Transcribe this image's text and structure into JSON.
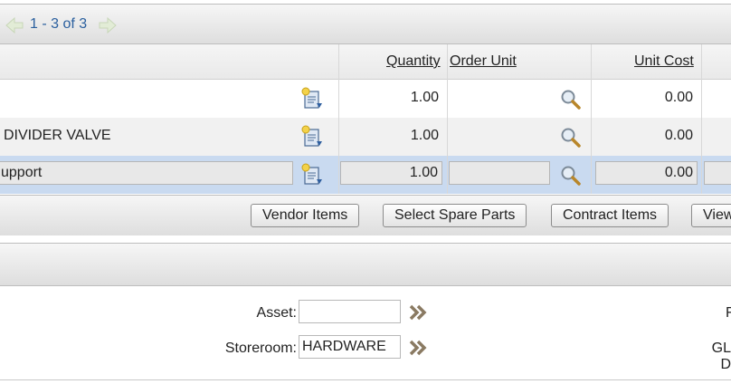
{
  "pager": {
    "range": "1 - 3 of 3",
    "prev_icon": "arrow-left-icon",
    "next_icon": "arrow-right-icon"
  },
  "columns": {
    "quantity": "Quantity",
    "order_unit": "Order Unit",
    "unit_cost": "Unit Cost"
  },
  "rows": [
    {
      "description": "",
      "quantity": "1.00",
      "order_unit": "",
      "unit_cost": "0.00"
    },
    {
      "description": "DIVIDER VALVE",
      "quantity": "1.00",
      "order_unit": "",
      "unit_cost": "0.00"
    },
    {
      "description": "upport",
      "quantity": "1.00",
      "order_unit": "",
      "unit_cost": "0.00"
    }
  ],
  "buttons": {
    "vendor_items": "Vendor Items",
    "select_spare_parts": "Select Spare Parts",
    "contract_items": "Contract Items",
    "view": "View"
  },
  "form": {
    "asset_label": "Asset:",
    "asset_value": "",
    "storeroom_label": "Storeroom:",
    "storeroom_value": "HARDWARE",
    "right_label_1": "F",
    "right_label_2": "GL D"
  },
  "colors": {
    "selected_row": "#c9daf0",
    "link": "#2a5f9e",
    "chevron": "#8a7a62"
  }
}
